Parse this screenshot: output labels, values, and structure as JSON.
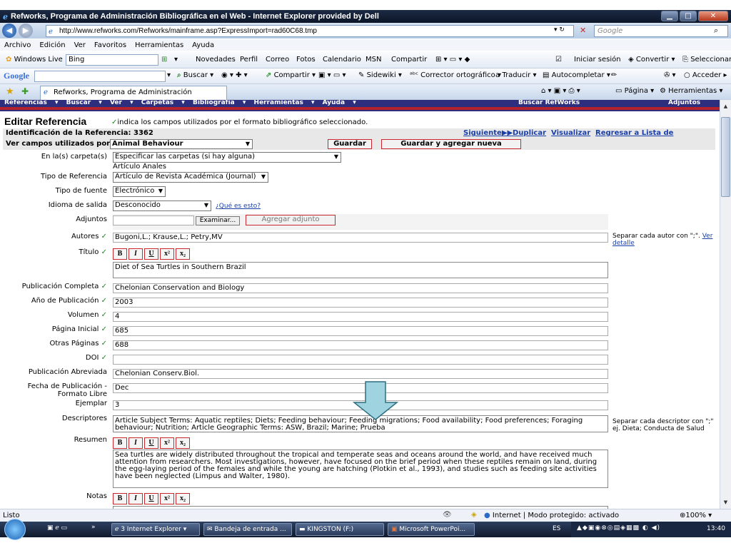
{
  "window": {
    "title": "Refworks, Programa de Administración Bibliográfica en el Web - Internet Explorer provided by Dell"
  },
  "addressbar": {
    "url": "http://www.refworks.com/Refworks/mainframe.asp?ExpressImport=rad60C68.tmp",
    "search_placeholder": "Google"
  },
  "menu": [
    "Archivo",
    "Edición",
    "Ver",
    "Favoritos",
    "Herramientas",
    "Ayuda"
  ],
  "live_toolbar": {
    "brand": "Windows Live",
    "search_value": "Bing",
    "links": [
      "Novedades",
      "Perfil",
      "Correo",
      "Fotos",
      "Calendario",
      "MSN",
      "Compartir"
    ],
    "signin": "Iniciar sesión",
    "convert": "Convertir",
    "select": "Seleccionar"
  },
  "google_toolbar": {
    "brand": "Google",
    "search": "Buscar",
    "share": "Compartir",
    "sidewiki": "Sidewiki",
    "spell": "Corrector ortográfico",
    "translate": "Traducir",
    "autofill": "Autocompletar",
    "signin": "Acceder"
  },
  "tabs": {
    "active": "Refworks, Programa de Administración Bibliográf...",
    "page": "Página",
    "tools": "Herramientas"
  },
  "refworks_nav": {
    "items": [
      "Referencias",
      "Buscar",
      "Ver",
      "Carpetas",
      "Bibliografía",
      "Herramientas",
      "Ayuda"
    ],
    "search": "Buscar RefWorks",
    "attachments": "Adjuntos"
  },
  "form": {
    "heading": "Editar Referencia",
    "heading_note": "indica los campos utilizados por el formato bibliográfico seleccionado.",
    "ref_id": "Identificación de la Referencia: 3362",
    "links": [
      "Siguiente",
      "Duplicar",
      "Visualizar",
      "Regresar a Lista de Referencias"
    ],
    "view_label": "Ver campos utilizados por:",
    "view_value": "Animal Behaviour",
    "save": "Guardar",
    "save_new": "Guardar y agregar nueva",
    "folder_label": "En la(s) carpeta(s)",
    "folder_value": "Especificar las carpetas (si hay alguna)",
    "folder_note": "Artículo Anales",
    "ref_type_label": "Tipo de Referencia",
    "ref_type_value": "Artículo de Revista Académica (Journal)",
    "source_label": "Tipo de fuente",
    "source_value": "Electrónico",
    "language_label": "Idioma de salida",
    "language_value": "Desconocido",
    "language_help": "¿Qué es esto?",
    "attach_label": "Adjuntos",
    "browse": "Examinar...",
    "add_attachment": "Agregar adjunto",
    "authors_label": "Autores",
    "authors_value": "Bugoni,L.; Krause,L.; Petry,MV",
    "authors_hint": "Separar cada autor con \";\".",
    "authors_hint_link": "Ver detalle",
    "title_label": "Título",
    "title_value": "Diet of Sea Turtles in Southern Brazil",
    "pub_label": "Publicación Completa",
    "pub_value": "Chelonian Conservation and Biology",
    "year_label": "Año de Publicación",
    "year_value": "2003",
    "volume_label": "Volumen",
    "volume_value": "4",
    "startpage_label": "Página Inicial",
    "startpage_value": "685",
    "otherpages_label": "Otras Páginas",
    "otherpages_value": "688",
    "doi_label": "DOI",
    "doi_value": "",
    "abbr_label": "Publicación Abreviada",
    "abbr_value": "Chelonian Conserv.Biol.",
    "date_label_1": "Fecha de Publicación -",
    "date_label_2": "Formato Libre",
    "date_value": "Dec",
    "copy_label": "Ejemplar",
    "copy_value": "3",
    "desc_label": "Descriptores",
    "desc_value": "Article Subject Terms: Aquatic reptiles; Diets; Feeding behaviour; Feeding migrations; Food availability; Food preferences; Foraging behaviour; Nutrition; Article Geographic Terms: ASW, Brazil; Marine; Prueba",
    "desc_hint": "Separar cada descriptor con \";\" ej. Dieta; Conducta de Salud",
    "abstract_label": "Resumen",
    "abstract_value": "Sea turtles are widely distributed throughout the tropical and temperate seas and oceans around the world, and have received much attention from researchers. Most investigations, however, have focused on the brief period when these reptiles remain on land, during the egg-laying period of the females and while the young are hatching (Plotkin et al., 1993), and studies such as feeding site activities have been neglected (Limpus and Walter, 1980).",
    "notes_label": "Notas"
  },
  "statusbar": {
    "left": "Listo",
    "zone": "Internet | Modo protegido: activado",
    "zoom": "100%"
  },
  "taskbar": {
    "items": [
      "3 Internet Explorer",
      "Bandeja de entrada ...",
      "KINGSTON (F:)",
      "Microsoft PowerPoi..."
    ],
    "lang": "ES",
    "time": "13:40"
  }
}
